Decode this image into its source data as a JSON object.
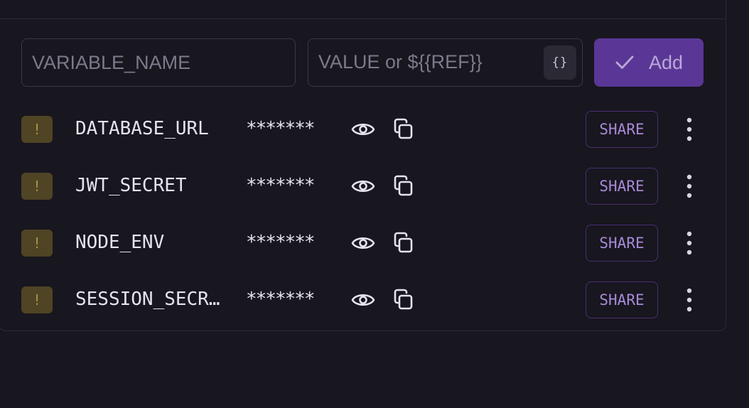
{
  "add_form": {
    "name_placeholder": "VARIABLE_NAME",
    "value_placeholder": "VALUE or ${{REF}}",
    "ref_button_label": "{}",
    "add_label": "Add"
  },
  "variables": [
    {
      "badge": "!",
      "name": "DATABASE_URL",
      "value": "*******",
      "share_label": "SHARE"
    },
    {
      "badge": "!",
      "name": "JWT_SECRET",
      "value": "*******",
      "share_label": "SHARE"
    },
    {
      "badge": "!",
      "name": "NODE_ENV",
      "value": "*******",
      "share_label": "SHARE"
    },
    {
      "badge": "!",
      "name": "SESSION_SECR…",
      "value": "*******",
      "share_label": "SHARE"
    }
  ],
  "icons": {
    "reveal": "eye-icon",
    "copy": "copy-icon",
    "more": "more-vertical-icon",
    "add": "check-icon"
  },
  "colors": {
    "accent": "#5a3796",
    "share_text": "#a88ad6",
    "warning": "#4f4424"
  }
}
